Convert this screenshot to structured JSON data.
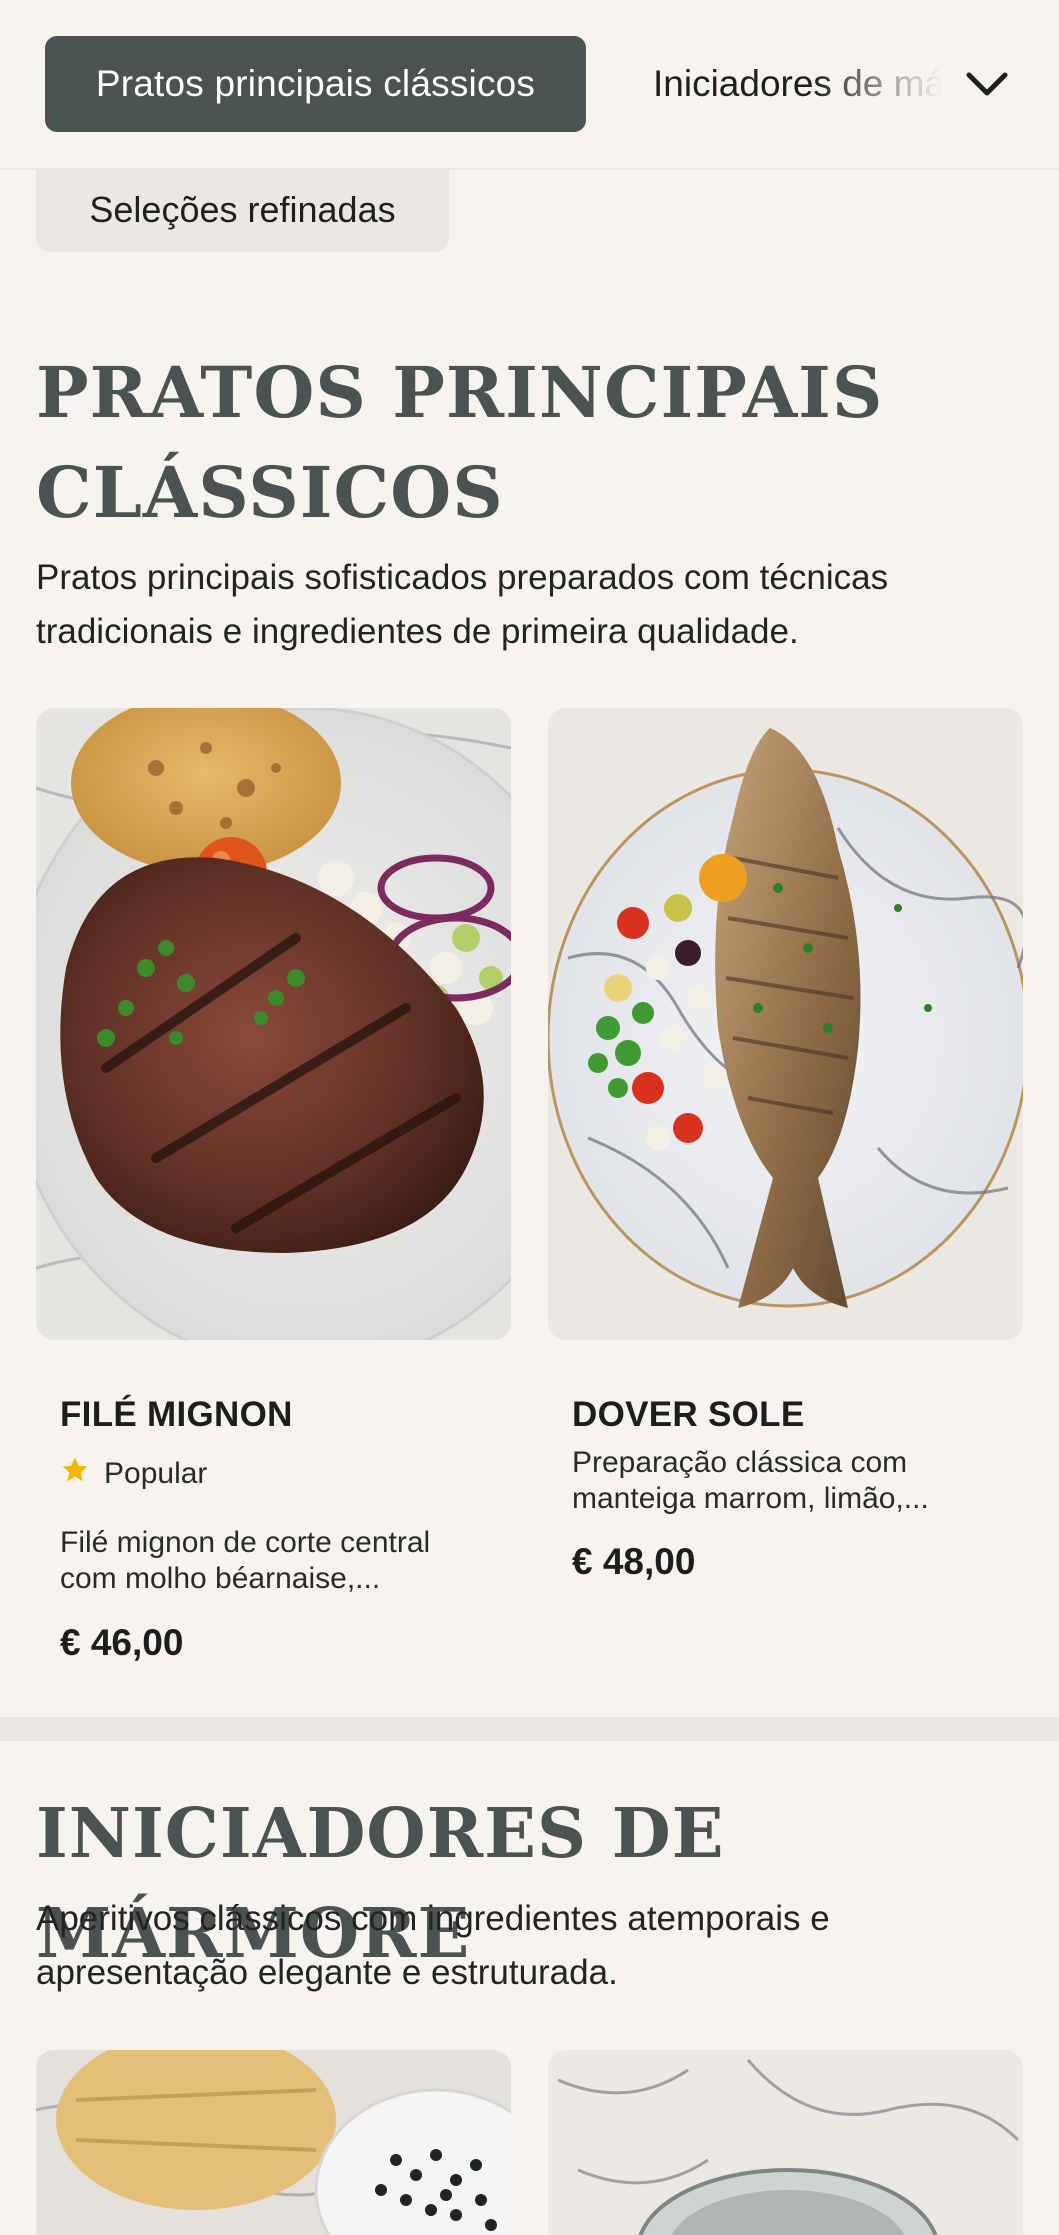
{
  "nav": {
    "active_label": "Pratos principais clássicos",
    "next_label": "Iniciadores de mármore",
    "sub_label": "Seleções refinadas",
    "chevron_icon": "chevron-down-icon"
  },
  "sections": [
    {
      "title_line1": "PRATOS PRINCIPAIS",
      "title_line2": "CLÁSSICOS",
      "description": "Pratos principais sofisticados preparados com técnicas tradicionais e ingredientes de primeira qualidade.",
      "items": [
        {
          "name": "FILÉ MIGNON",
          "badge": "Popular",
          "badge_icon": "star-icon",
          "description": "Filé mignon de corte central com molho béarnaise,...",
          "price": "€ 46,00"
        },
        {
          "name": "DOVER SOLE",
          "description": "Preparação clássica com manteiga marrom, limão,...",
          "price": "€ 48,00"
        }
      ]
    },
    {
      "title": "INICIADORES DE MÁRMORE",
      "description": "Aperitivos clássicos com ingredientes atemporais e apresentação elegante e estruturada."
    }
  ],
  "colors": {
    "background": "#f7f4ef",
    "accent": "#4a5352",
    "star": "#f2b705"
  }
}
